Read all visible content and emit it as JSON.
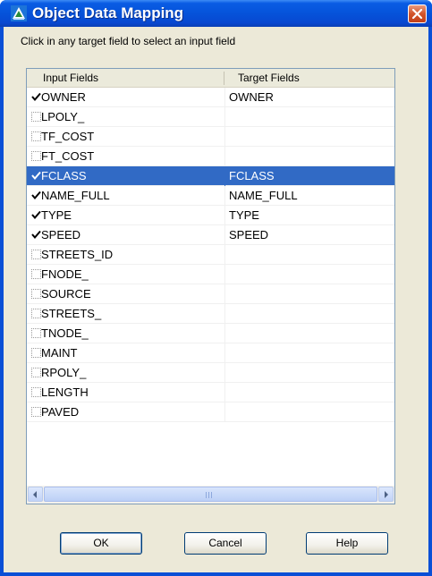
{
  "window": {
    "title": "Object Data Mapping"
  },
  "instruction": "Click in any target field to select an input field",
  "table": {
    "columns": [
      "Input Fields",
      "Target Fields"
    ],
    "rows": [
      {
        "input": "OWNER",
        "target": "OWNER",
        "checked": true,
        "selected": false
      },
      {
        "input": "LPOLY_",
        "target": "",
        "checked": false,
        "selected": false
      },
      {
        "input": "TF_COST",
        "target": "",
        "checked": false,
        "selected": false
      },
      {
        "input": "FT_COST",
        "target": "",
        "checked": false,
        "selected": false
      },
      {
        "input": "FCLASS",
        "target": "FCLASS",
        "checked": true,
        "selected": true
      },
      {
        "input": "NAME_FULL",
        "target": "NAME_FULL",
        "checked": true,
        "selected": false
      },
      {
        "input": "TYPE",
        "target": "TYPE",
        "checked": true,
        "selected": false
      },
      {
        "input": "SPEED",
        "target": "SPEED",
        "checked": true,
        "selected": false
      },
      {
        "input": "STREETS_ID",
        "target": "",
        "checked": false,
        "selected": false
      },
      {
        "input": "FNODE_",
        "target": "",
        "checked": false,
        "selected": false
      },
      {
        "input": "SOURCE",
        "target": "",
        "checked": false,
        "selected": false
      },
      {
        "input": "STREETS_",
        "target": "",
        "checked": false,
        "selected": false
      },
      {
        "input": "TNODE_",
        "target": "",
        "checked": false,
        "selected": false
      },
      {
        "input": "MAINT",
        "target": "",
        "checked": false,
        "selected": false
      },
      {
        "input": "RPOLY_",
        "target": "",
        "checked": false,
        "selected": false
      },
      {
        "input": "LENGTH",
        "target": "",
        "checked": false,
        "selected": false
      },
      {
        "input": "PAVED",
        "target": "",
        "checked": false,
        "selected": false
      }
    ]
  },
  "buttons": {
    "ok": "OK",
    "cancel": "Cancel",
    "help": "Help"
  },
  "colors": {
    "selection": "#316ac5",
    "title_bar": "#0553da",
    "dialog_background": "#ece9d8"
  },
  "icons": {
    "app": "autocad-map-icon",
    "close": "close-icon",
    "check": "checkmark-icon",
    "scroll_left": "arrow-left-icon",
    "scroll_right": "arrow-right-icon"
  }
}
